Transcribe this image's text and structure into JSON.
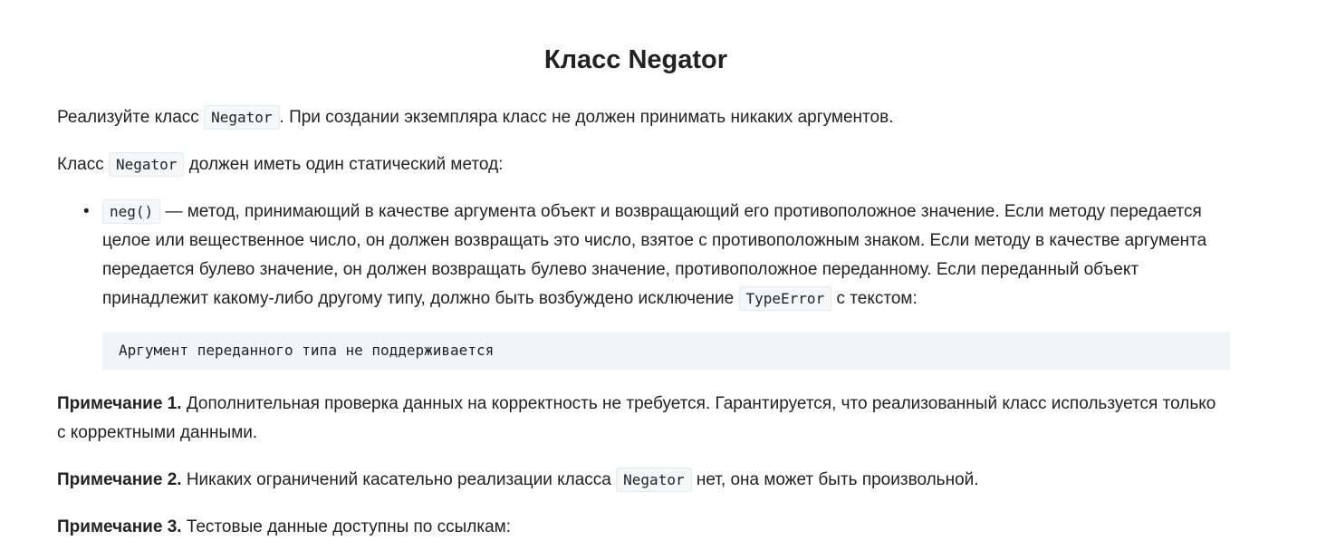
{
  "title": "Класс Negator",
  "p1": {
    "before": "Реализуйте класс ",
    "code": "Negator",
    "after": ". При создании экземпляра класс не должен принимать никаких аргументов."
  },
  "p2": {
    "before": "Класс ",
    "code": "Negator",
    "after": " должен иметь один статический метод:"
  },
  "list_item": {
    "bullet": "•",
    "code": "neg()",
    "text": " — метод, принимающий в качестве аргумента объект и возвращающий его противоположное значение. Если методу передается целое или вещественное число, он должен возвращать это число, взятое с противоположным знаком. Если методу в качестве аргумента передается булево значение, он должен возвращать булево значение, противоположное переданному. Если переданный объект принадлежит какому-либо другому типу, должно быть возбуждено исключение ",
    "code2": "TypeError",
    "after": " с текстом:"
  },
  "code_block": "Аргумент переданного типа не поддерживается",
  "note1": {
    "label": "Примечание 1.",
    "text": " Дополнительная проверка данных на корректность не требуется. Гарантируется, что реализованный класс используется только с корректными данными."
  },
  "note2": {
    "label": "Примечание 2.",
    "before": " Никаких ограничений касательно реализации класса ",
    "code": "Negator",
    "after": " нет, она может быть произвольной."
  },
  "note3": {
    "label": "Примечание 3.",
    "text": " Тестовые данные доступны по ссылкам:"
  }
}
